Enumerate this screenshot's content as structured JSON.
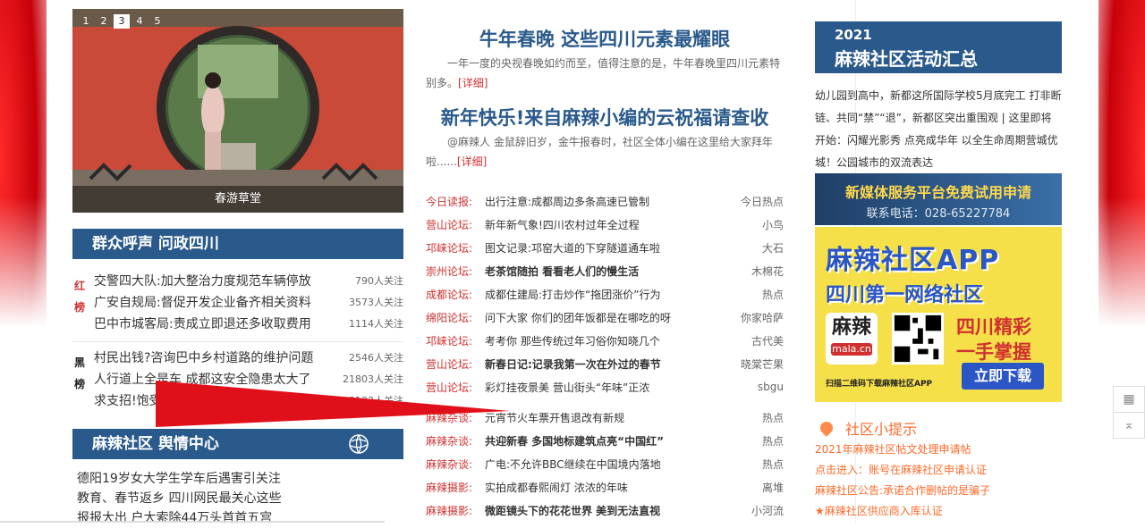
{
  "slider": {
    "dots": [
      "1",
      "2",
      "3",
      "4",
      "5"
    ],
    "active_dot": 3,
    "caption": "春游草堂"
  },
  "section1": {
    "title": "群众呼声 问政四川",
    "red_badge": [
      "红",
      "榜"
    ],
    "black_badge": [
      "黑",
      "榜"
    ],
    "red_items": [
      {
        "title": "交警四大队:加大整治力度规范车辆停放",
        "count": "790人关注"
      },
      {
        "title": "广安自规局:督促开发企业备齐相关资料",
        "count": "3573人关注"
      },
      {
        "title": "巴中市城客局:责成立即退还多收取费用",
        "count": "1114人关注"
      }
    ],
    "black_items": [
      {
        "title": "村民出钱?咨询巴中乡村道路的维护问题",
        "count": "2546人关注"
      },
      {
        "title": "人行道上全是车 成都这安全隐患太大了",
        "count": "21803人关注"
      },
      {
        "title": "求支招!饱受",
        "count": "2133人关注"
      }
    ]
  },
  "section2": {
    "title": "麻辣社区 舆情中心",
    "globe_icon": "globe-icon",
    "items": [
      "德阳19岁女大学生学车后遇害引关注",
      "教育、春节返乡 四川网民最关心这些",
      "报报大出 户大索除44万头首首五宫"
    ]
  },
  "middle": {
    "headline1": "牛年春晚 这些四川元素最耀眼",
    "summary1": "一年一度的央视春晚如约而至，值得注意的是，牛年春晚里四川元素特别多。",
    "more1": "[详细]",
    "headline2": "新年快乐!来自麻辣小编的云祝福请查收",
    "summary2": "@麻辣人 金鼠辞旧岁，金牛报春时，社区全体小编在这里给大家拜年啦......",
    "more2": "[详细]",
    "list": [
      {
        "cat": "今日读报:",
        "title": "出行注意:成都周边多条高速已管制",
        "author": "今日热点",
        "bold": false
      },
      {
        "cat": "营山论坛:",
        "title": "新年新气象!四川农村过年全过程",
        "author": "小鸟",
        "bold": false
      },
      {
        "cat": "邛崃论坛:",
        "title": "图文记录:邛窑大道的下穿隧道通车啦",
        "author": "大石",
        "bold": false
      },
      {
        "cat": "崇州论坛:",
        "title": "老茶馆随拍 看看老人们的慢生活",
        "author": "木棉花",
        "bold": true
      },
      {
        "cat": "成都论坛:",
        "title": "成都住建局:打击炒作“拖团涨价”行为",
        "author": "热点",
        "bold": false
      },
      {
        "cat": "绵阳论坛:",
        "title": "问下大家 你们的团年饭都是在哪吃的呀",
        "author": "你家哈萨",
        "bold": false
      },
      {
        "cat": "邛崃论坛:",
        "title": "考考你 那些传统过年习俗你知晓几个",
        "author": "古代美",
        "bold": false
      },
      {
        "cat": "营山论坛:",
        "title": "新春日记:记录我第一次在外过的春节",
        "author": "晓棠芒果",
        "bold": true
      },
      {
        "cat": "营山论坛:",
        "title": "彩灯挂夜景美 营山街头“年味”正浓",
        "author": "sbgu",
        "bold": false
      },
      {
        "cat": "麻辣杂谈:",
        "title": "元宵节火车票开售退改有新规",
        "author": "热点",
        "bold": false
      },
      {
        "cat": "麻辣杂谈:",
        "title": "共迎新春 多国地标建筑点亮“中国红”",
        "author": "热点",
        "bold": true
      },
      {
        "cat": "麻辣杂谈:",
        "title": "广电:不允许BBC继续在中国境内落地",
        "author": "热点",
        "bold": false
      },
      {
        "cat": "麻辣摄影:",
        "title": "实拍成都春熙闹灯 浓浓的年味",
        "author": "离堆",
        "bold": false
      },
      {
        "cat": "麻辣摄影:",
        "title": "微距镜头下的花花世界 美到无法直视",
        "author": "小河流",
        "bold": true
      }
    ]
  },
  "right": {
    "year": "2021",
    "title": "麻辣社区活动汇总",
    "text": "幼儿园到高中，新都这所国际学校5月底完工 打非断链、共同“禁”“退”，新都区突出重围观 | 这里即将开始：闪耀光影秀 点亮成华年 以全生命周期营城优城！公园城市的双流表达",
    "ad": {
      "title": "新媒体服务平台免费试用申请",
      "phone": "联系电话：028-65227784"
    },
    "app": {
      "title": "麻辣社区APP",
      "subtitle": "四川第一网络社区",
      "logo": "麻辣",
      "logo_sub": "mala.cn",
      "slogan1": "四川精彩",
      "slogan2": "一手掌握",
      "download": "立即下载",
      "caption": "扫描二维码下载麻辣社区APP"
    },
    "tips_title": "社区小提示",
    "tips": [
      "2021年麻辣社区帖文处理申请帖",
      "点击进入：账号在麻辣社区申请认证",
      "麻辣社区公告:承诺合作删帖的是骗子",
      "★麻辣社区供应商入库认证"
    ]
  },
  "side": {
    "qr_icon": "qr-icon",
    "top_icon": "back-to-top-icon"
  }
}
